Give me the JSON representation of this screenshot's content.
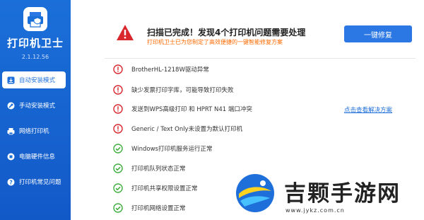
{
  "app": {
    "title": "打印机卫士",
    "version": "2.1.12.56"
  },
  "nav": [
    {
      "label": "自动安装模式",
      "icon": "auto-install-icon",
      "active": true
    },
    {
      "label": "手动安装模式",
      "icon": "wrench-icon"
    },
    {
      "label": "网络打印机",
      "icon": "network-printer-icon"
    },
    {
      "label": "电脑硬件信息",
      "icon": "hardware-icon"
    },
    {
      "label": "打印机常见问题",
      "icon": "help-icon"
    }
  ],
  "header": {
    "title": "扫描已完成！发现4个打印机问题需要处理",
    "subtitle": "打印机卫士已为您制定了高效便捷的一键智能修复方案",
    "fix_button": "一键修复"
  },
  "issues": [
    {
      "text": "BrotherHL-1218W驱动异常",
      "status": "error"
    },
    {
      "text": "缺少发票打印字库，可能导致打印失败",
      "status": "error"
    },
    {
      "text": "发送到WPS高级打印 和 HPRT N41 端口冲突",
      "status": "error",
      "link": "点击查看解决方案"
    },
    {
      "text": "Generic / Text Only未设置为默认打印机",
      "status": "error"
    },
    {
      "text": "Windows打印机服务运行正常",
      "status": "ok"
    },
    {
      "text": "打印机队列状态正常",
      "status": "ok"
    },
    {
      "text": "打印机共享权限设置正常",
      "status": "ok"
    },
    {
      "text": "打印机网络设置正常",
      "status": "ok"
    }
  ],
  "watermark": {
    "text": "吉颗手游网",
    "url": "www.jykz.com.cn"
  },
  "colors": {
    "sidebar": "#1b6fd8",
    "accent": "#2b78e4",
    "error": "#d9272e",
    "ok": "#3fae3f",
    "warning_text": "#ff6a00"
  }
}
